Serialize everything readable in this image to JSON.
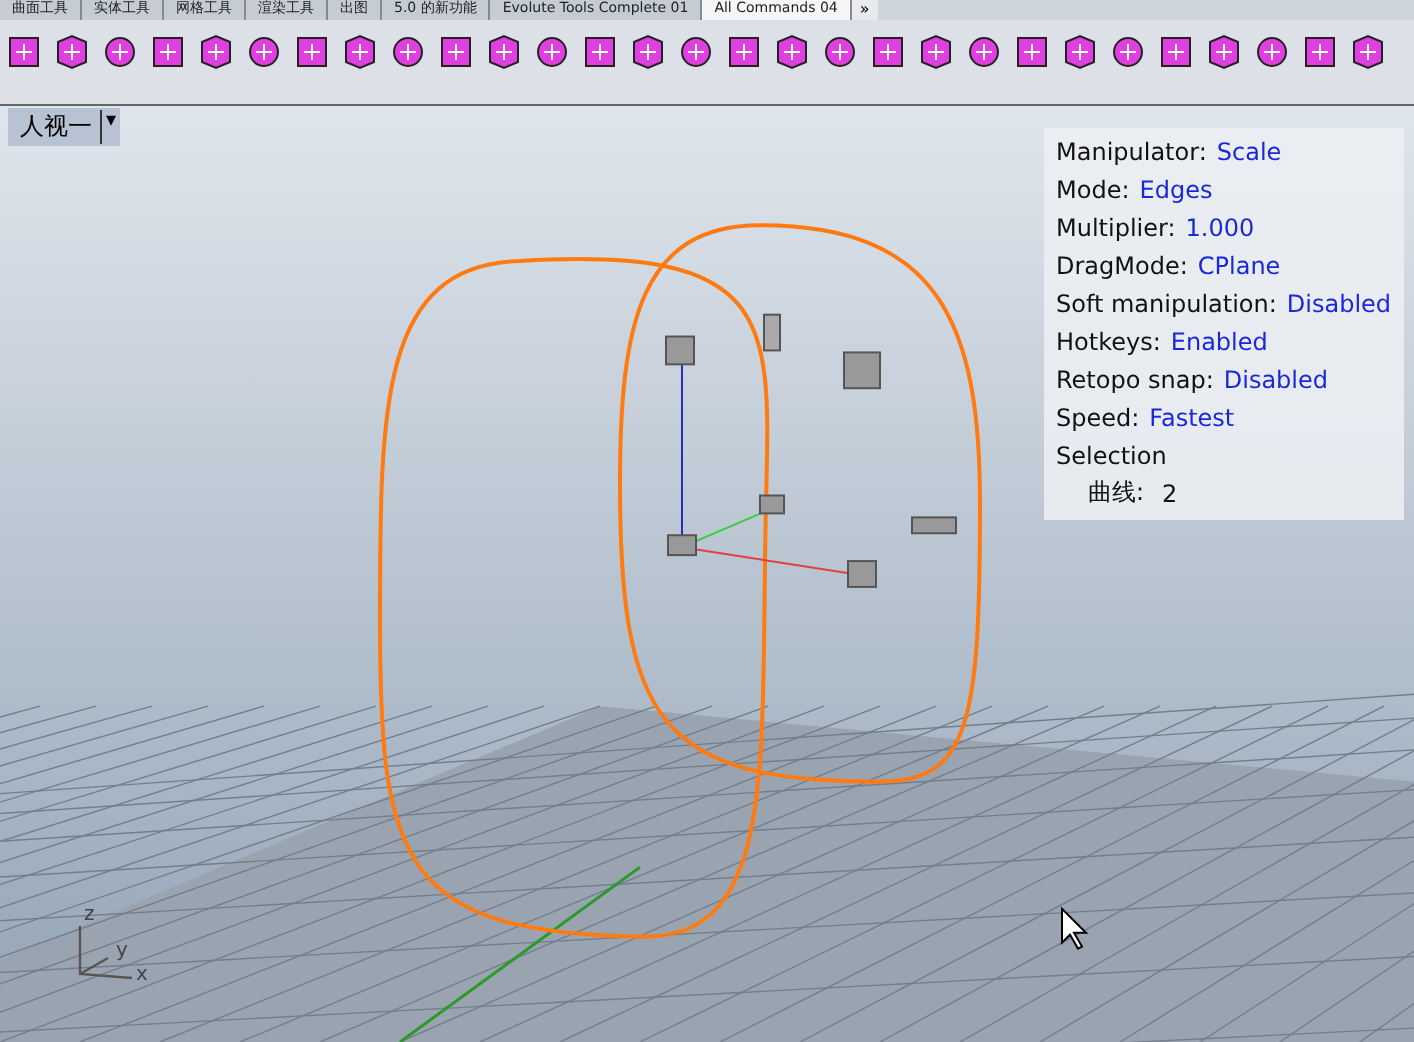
{
  "tabs": [
    {
      "label": "曲面工具",
      "selected": false
    },
    {
      "label": "实体工具",
      "selected": false
    },
    {
      "label": "网格工具",
      "selected": false
    },
    {
      "label": "渲染工具",
      "selected": false
    },
    {
      "label": "出图",
      "selected": false
    },
    {
      "label": "5.0 的新功能",
      "selected": false
    },
    {
      "label": "Evolute Tools Complete 01",
      "selected": false
    },
    {
      "label": "All Commands 04",
      "selected": true
    }
  ],
  "tab_overflow": "»",
  "viewport": {
    "label": "人视一",
    "dropdown_arrow": "▾",
    "info_panel": {
      "rows": [
        {
          "label": "Manipulator:",
          "value": "Scale"
        },
        {
          "label": "Mode:",
          "value": "Edges"
        },
        {
          "label": "Multiplier:",
          "value": "1.000"
        },
        {
          "label": "DragMode:",
          "value": "CPlane"
        },
        {
          "label": "Soft manipulation:",
          "value": "Disabled"
        },
        {
          "label": "Hotkeys:",
          "value": "Enabled"
        },
        {
          "label": "Retopo snap:",
          "value": "Disabled"
        },
        {
          "label": "Speed:",
          "value": "Fastest"
        }
      ],
      "selection": {
        "label": "Selection",
        "children": [
          {
            "label": "曲线:",
            "value": "2"
          }
        ]
      }
    },
    "axes": {
      "z": "z",
      "y": "y",
      "x": "x"
    }
  }
}
